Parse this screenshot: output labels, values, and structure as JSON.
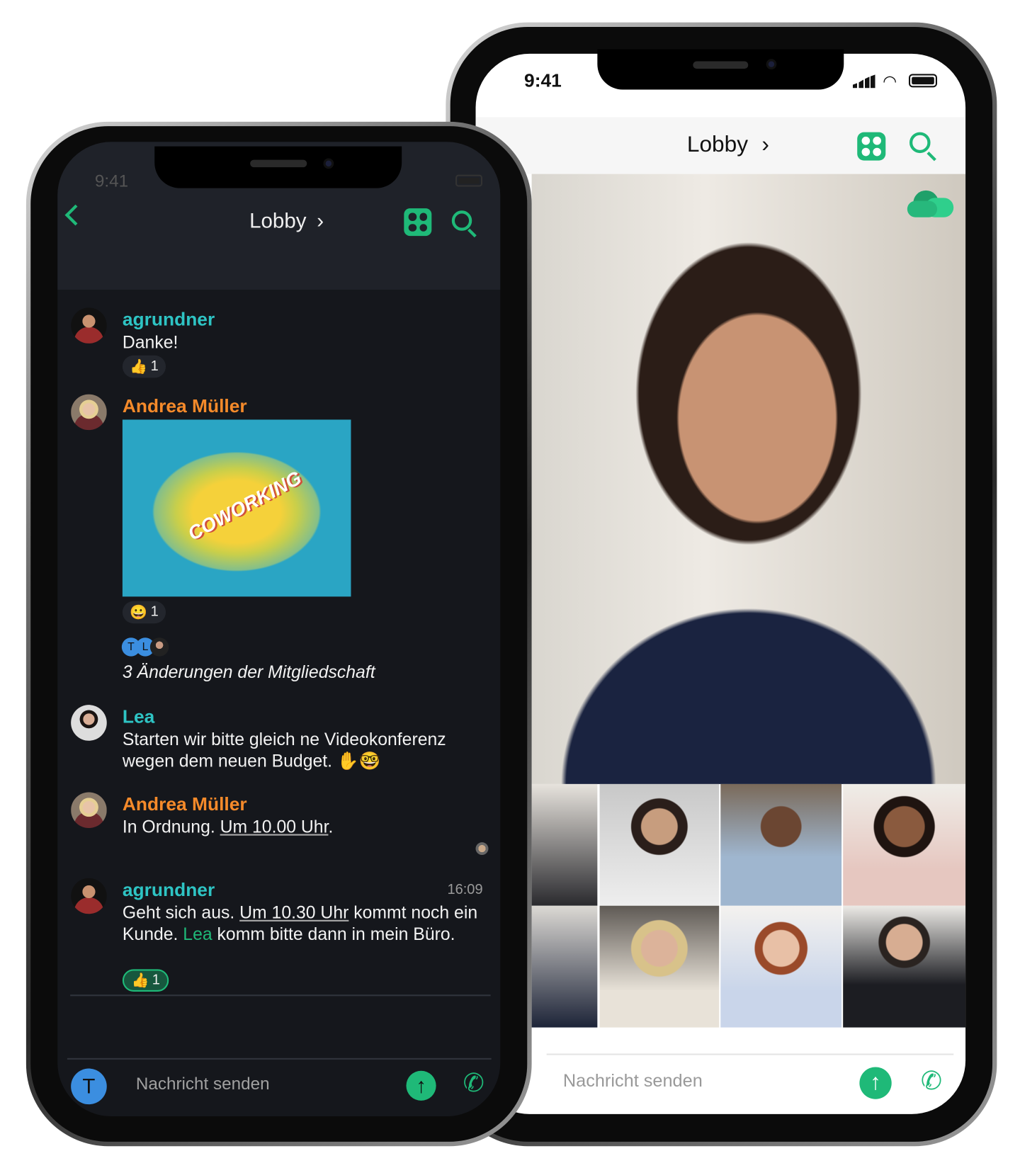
{
  "colors": {
    "accent": "#1fb978",
    "teal_name": "#2ec4c4",
    "orange_name": "#f58a2a",
    "dark_bg": "#15171c",
    "dark_header": "#1f2229",
    "avatar_blue": "#3b8ee0"
  },
  "front_phone": {
    "status_time": "9:41",
    "header": {
      "back_icon": "chevron-left-icon",
      "title": "Lobby",
      "title_chevron": "›",
      "apps_icon": "grid-icon",
      "search_icon": "search-icon"
    },
    "messages": [
      {
        "sender": "agrundner",
        "text": "Danke!",
        "reaction": {
          "emoji": "👍",
          "count": "1"
        }
      },
      {
        "sender": "Andrea Müller",
        "image_caption": "COWORKING",
        "reaction": {
          "emoji": "😀",
          "count": "1"
        }
      },
      {
        "membership": {
          "avatars": [
            "T",
            "L"
          ],
          "text": "3 Änderungen der Mitgliedschaft"
        }
      },
      {
        "sender": "Lea",
        "text": "Starten wir bitte gleich ne Videokonferenz wegen dem neuen Budget. ✋🤓"
      },
      {
        "sender": "Andrea Müller",
        "text_before": "In Ordnung. ",
        "link": "Um 10.00 Uhr",
        "text_after": "."
      },
      {
        "sender": "agrundner",
        "time": "16:09",
        "part1": "Geht sich aus. ",
        "link": "Um 10.30 Uhr",
        "part2": " kommt noch ein Kunde. ",
        "mention": "Lea",
        "part3": " komm bitte dann in mein Büro.",
        "reaction": {
          "emoji": "👍",
          "count": "1"
        }
      }
    ],
    "composer": {
      "avatar_letter": "T",
      "placeholder": "Nachricht senden",
      "send_icon": "arrow-up-icon",
      "call_icon": "phone-icon"
    }
  },
  "back_phone": {
    "status_time": "9:41",
    "header": {
      "title": "Lobby",
      "title_chevron": "›",
      "apps_icon": "grid-icon",
      "search_icon": "search-icon"
    },
    "cloud_icon": "cloud-icon",
    "composer": {
      "placeholder": "Nachricht senden",
      "send_icon": "arrow-up-icon",
      "call_icon": "phone-icon"
    }
  }
}
